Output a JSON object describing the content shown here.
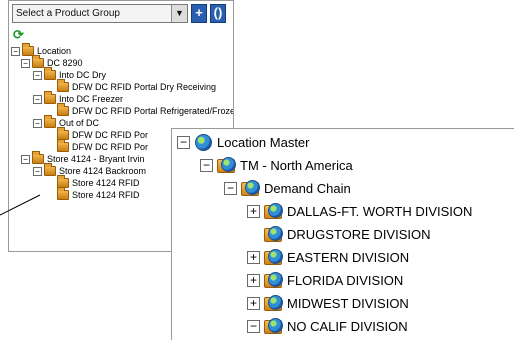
{
  "small_panel": {
    "select_label": "Select a Product Group",
    "add_label": "+",
    "refresh_label": "()",
    "tree": [
      {
        "text": "Location",
        "exp": "−"
      },
      {
        "text": "DC 8290",
        "exp": "−"
      },
      {
        "text": "Into DC Dry",
        "exp": "−"
      },
      {
        "text": "DFW DC RFID Portal Dry Receiving",
        "exp": ""
      },
      {
        "text": "Into DC Freezer",
        "exp": "−"
      },
      {
        "text": "DFW DC RFID Portal Refrigerated/Frozen Receiving",
        "exp": ""
      },
      {
        "text": "Out of DC",
        "exp": "−"
      },
      {
        "text": "DFW DC RFID Por",
        "exp": ""
      },
      {
        "text": "DFW DC RFID Por",
        "exp": ""
      },
      {
        "text": "Store 4124 - Bryant Irvin",
        "exp": "−"
      },
      {
        "text": "Store 4124 Backroom",
        "exp": "−"
      },
      {
        "text": "Store 4124 RFID",
        "exp": ""
      },
      {
        "text": "Store 4124 RFID",
        "exp": ""
      }
    ]
  },
  "large_panel": {
    "tree": [
      {
        "text": "Location Master",
        "exp": "−",
        "icon": "globe"
      },
      {
        "text": "TM - North America",
        "exp": "−",
        "icon": "folder-globe"
      },
      {
        "text": "Demand Chain",
        "exp": "−",
        "icon": "folder-globe"
      },
      {
        "text": "DALLAS-FT. WORTH DIVISION",
        "exp": "+",
        "icon": "folder-globe"
      },
      {
        "text": "DRUGSTORE DIVISION",
        "exp": "",
        "icon": "folder-globe"
      },
      {
        "text": "EASTERN DIVISION",
        "exp": "+",
        "icon": "folder-globe"
      },
      {
        "text": "FLORIDA DIVISION",
        "exp": "+",
        "icon": "folder-globe"
      },
      {
        "text": "MIDWEST DIVISION",
        "exp": "+",
        "icon": "folder-globe"
      },
      {
        "text": "NO CALIF DIVISION",
        "exp": "−",
        "icon": "folder-globe"
      }
    ]
  }
}
